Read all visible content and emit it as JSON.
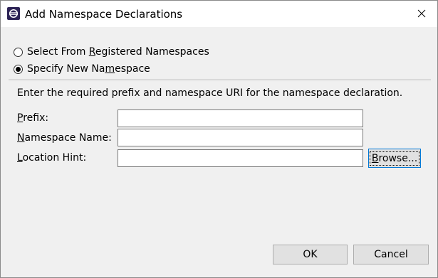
{
  "window": {
    "title": "Add Namespace Declarations"
  },
  "radios": [
    {
      "label_pre": "Select From ",
      "label_mnemonic": "R",
      "label_post": "egistered Namespaces",
      "checked": false
    },
    {
      "label_pre": "Specify New Na",
      "label_mnemonic": "m",
      "label_post": "espace",
      "checked": true
    }
  ],
  "instruction": "Enter the required prefix and namespace URI for the namespace declaration.",
  "fields": {
    "prefix": {
      "label_mnemonic": "P",
      "label_post": "refix:",
      "value": ""
    },
    "namespace_name": {
      "label_mnemonic": "N",
      "label_post": "amespace Name:",
      "value": ""
    },
    "location_hint": {
      "label_mnemonic": "L",
      "label_post": "ocation Hint:",
      "value": ""
    }
  },
  "buttons": {
    "browse_mnemonic": "B",
    "browse_post": "rowse...",
    "ok": "OK",
    "cancel": "Cancel"
  },
  "icons": {
    "app": "eclipse-icon",
    "close": "close-icon"
  }
}
